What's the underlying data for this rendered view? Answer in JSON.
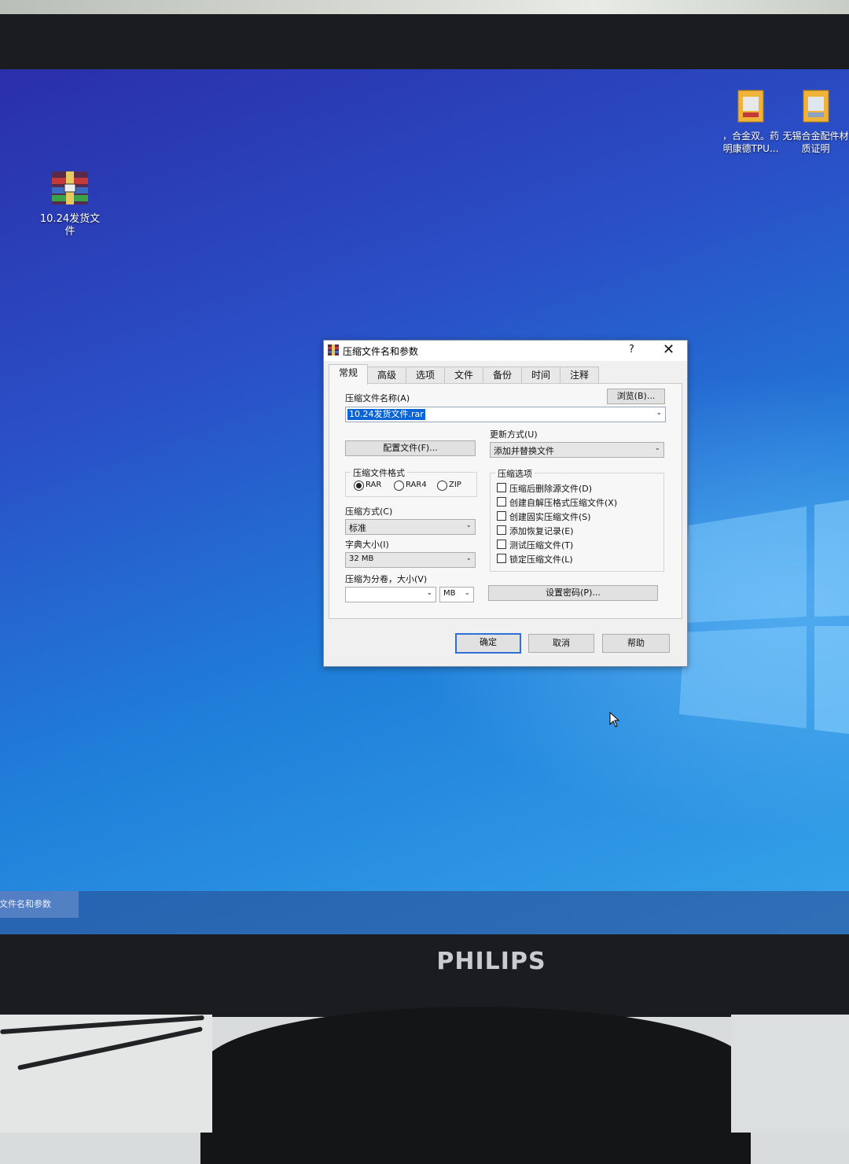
{
  "desktop": {
    "icons": [
      {
        "label": "10.24发货文件",
        "icon": "winrar-archive-icon"
      },
      {
        "label": "，合金双。药明康德TPU...",
        "icon": "document-archive-icon"
      },
      {
        "label": "无锡合金配件材质证明",
        "icon": "document-archive-icon"
      }
    ]
  },
  "taskbar": {
    "active_window": "缩文件名和参数"
  },
  "monitor": {
    "brand": "PHILIPS"
  },
  "dialog": {
    "title": "压缩文件名和参数",
    "help_glyph": "?",
    "close_glyph": "✕",
    "tabs": [
      {
        "label": "常规",
        "active": true
      },
      {
        "label": "高级",
        "active": false
      },
      {
        "label": "选项",
        "active": false
      },
      {
        "label": "文件",
        "active": false
      },
      {
        "label": "备份",
        "active": false
      },
      {
        "label": "时间",
        "active": false
      },
      {
        "label": "注释",
        "active": false
      }
    ],
    "general": {
      "archive_name_label": "压缩文件名称(A)",
      "browse_button": "浏览(B)...",
      "archive_name_value": "10.24发货文件.rar",
      "profiles_button": "配置文件(F)...",
      "update_mode_label": "更新方式(U)",
      "update_mode_value": "添加并替换文件",
      "format_group_title": "压缩文件格式",
      "formats": [
        {
          "label": "RAR",
          "selected": true
        },
        {
          "label": "RAR4",
          "selected": false
        },
        {
          "label": "ZIP",
          "selected": false
        }
      ],
      "method_label": "压缩方式(C)",
      "method_value": "标准",
      "dict_label": "字典大小(I)",
      "dict_value": "32 MB",
      "split_label": "压缩为分卷，大小(V)",
      "split_value": "",
      "split_unit": "MB",
      "options_group_title": "压缩选项",
      "options": [
        {
          "label": "压缩后删除源文件(D)",
          "checked": false
        },
        {
          "label": "创建自解压格式压缩文件(X)",
          "checked": false
        },
        {
          "label": "创建固实压缩文件(S)",
          "checked": false
        },
        {
          "label": "添加恢复记录(E)",
          "checked": false
        },
        {
          "label": "测试压缩文件(T)",
          "checked": false
        },
        {
          "label": "锁定压缩文件(L)",
          "checked": false
        }
      ],
      "password_button": "设置密码(P)..."
    },
    "buttons": {
      "ok": "确定",
      "cancel": "取消",
      "help": "帮助"
    }
  },
  "colors": {
    "desktop_top": "#2a2fa8",
    "desktop_bottom": "#36a4ea",
    "selection": "#0a64d6",
    "default_button_border": "#2f6fd6"
  }
}
